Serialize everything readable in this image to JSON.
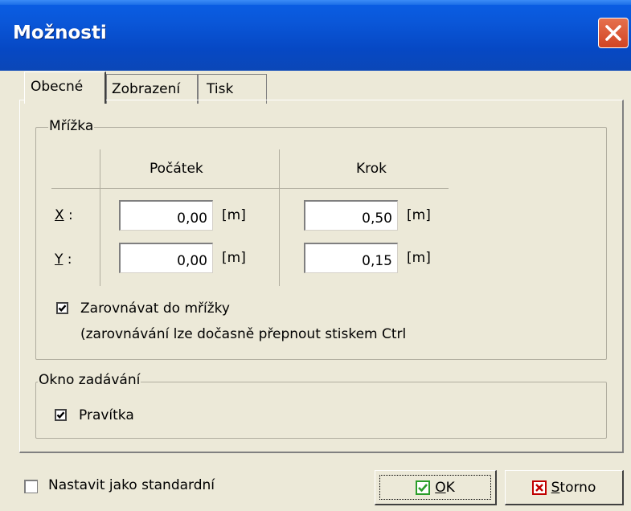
{
  "window": {
    "title": "Možnosti",
    "close_icon": "close-icon"
  },
  "tabs": [
    {
      "label": "Obecné",
      "active": true
    },
    {
      "label": "Zobrazení",
      "active": false
    },
    {
      "label": "Tisk",
      "active": false
    }
  ],
  "grid_group": {
    "label": "Mřížka",
    "col_origin": "Počátek",
    "col_step": "Krok",
    "row_x": {
      "key": "X",
      "suffix": " :",
      "origin": "0,00",
      "step": "0,50"
    },
    "row_y": {
      "key": "Y",
      "suffix": " :",
      "origin": "0,00",
      "step": "0,15"
    },
    "unit": "[m]",
    "snap_checkbox": {
      "label": "Zarovnávat do mřížky",
      "checked": true
    },
    "snap_note": "(zarovnávání lze dočasně přepnout stiskem Ctrl"
  },
  "input_group": {
    "label": "Okno zadávání",
    "rulers_checkbox": {
      "label": "Pravítka",
      "checked": true
    }
  },
  "footer": {
    "default_checkbox": {
      "label": "Nastavit jako standardní",
      "checked": false
    },
    "ok_button": {
      "key": "O",
      "rest": "K",
      "icon": "checkmark-icon"
    },
    "cancel_button": {
      "key": "S",
      "rest": "torno",
      "icon": "cross-icon"
    }
  },
  "colors": {
    "titlebar": "#0a57d9",
    "close": "#d14423",
    "face": "#ece9d8",
    "ok_icon": "#2a9d2a",
    "cancel_icon": "#c00000"
  }
}
